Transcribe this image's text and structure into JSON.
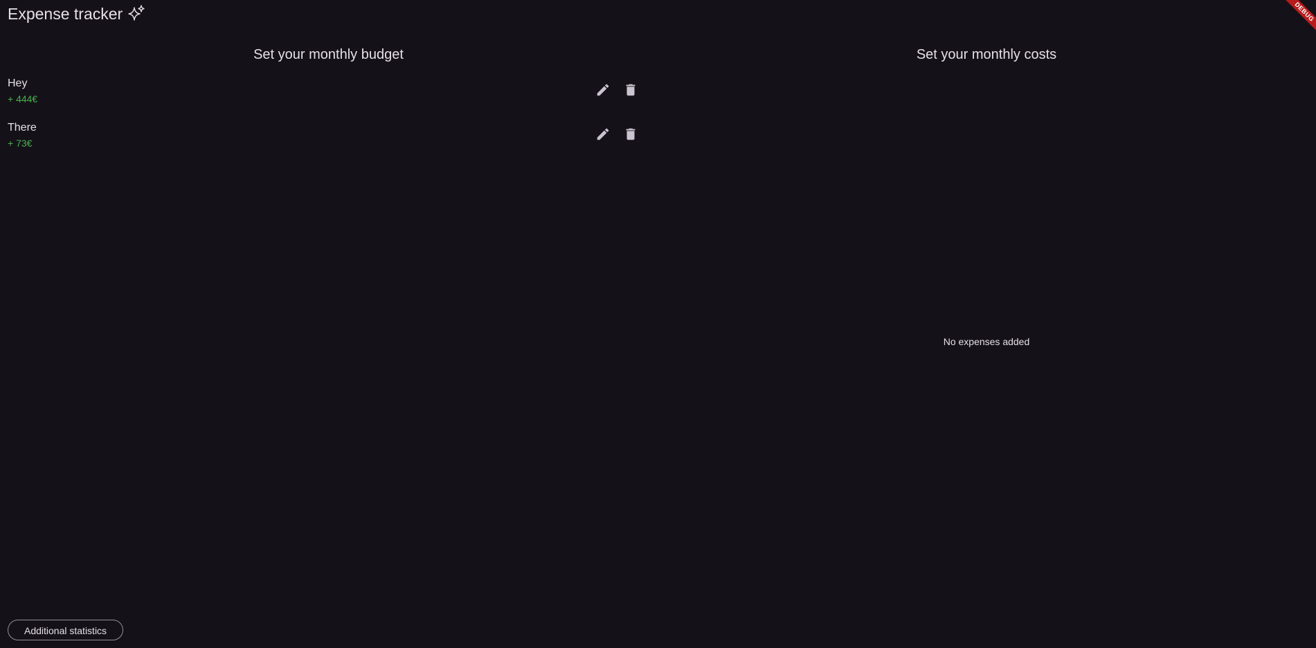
{
  "app_bar": {
    "title": "Expense tracker",
    "title_icon": "sparkle-icon"
  },
  "debug_banner": {
    "label": "DEBUG",
    "color": "#b71c1c"
  },
  "budget": {
    "title": "Set your monthly budget",
    "items": [
      {
        "name": "Hey",
        "amount": "+ 444€"
      },
      {
        "name": "There",
        "amount": "+ 73€"
      }
    ],
    "amount_color": "#4caf50",
    "edit_icon": "pencil-icon",
    "delete_icon": "trash-icon"
  },
  "costs": {
    "title": "Set your monthly costs",
    "empty_message": "No expenses added"
  },
  "footer": {
    "stats_button_label": "Additional statistics"
  }
}
